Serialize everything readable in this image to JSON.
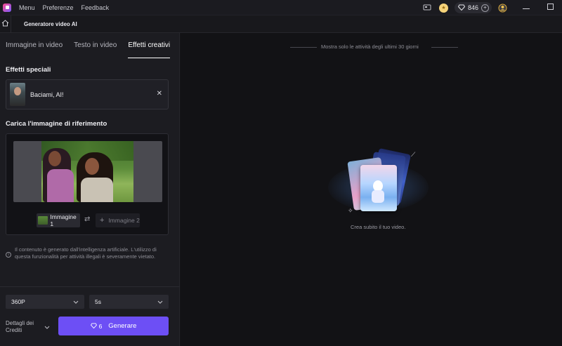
{
  "titlebar": {
    "menu_items": [
      "Menu",
      "Preferenze",
      "Feedback"
    ],
    "credits": "846",
    "icons": [
      "app-logo-icon",
      "monitor-icon",
      "coin-icon",
      "gem-icon",
      "plus-icon",
      "user-badge-icon",
      "minimize-icon",
      "maximize-icon"
    ]
  },
  "subbar": {
    "title": "Generatore video AI"
  },
  "left": {
    "tabs": [
      {
        "label": "Immagine in video",
        "active": false
      },
      {
        "label": "Testo in video",
        "active": false
      },
      {
        "label": "Effetti creativi",
        "active": true
      }
    ],
    "effects_title": "Effetti speciali",
    "effect": {
      "name": "Baciami, AI!"
    },
    "upload_title": "Carica l'immagine di riferimento",
    "image1_label": "Immagine 1",
    "image2_label": "Immagine 2",
    "notice": "Il contenuto è generato dall'intelligenza artificiale. L'utilizzo di questa funzionalità per attività illegali è severamente vietato.",
    "resolution": "360P",
    "duration": "5s",
    "details_label": "Dettagli dei Crediti",
    "generate": {
      "cost": "6",
      "label": "Generare"
    }
  },
  "right": {
    "filter_text": "Mostra solo le attività degli ultimi 30 giorni",
    "empty_caption": "Crea subito il tuo video."
  },
  "colors": {
    "accent": "#6d4ff5",
    "panel": "#1c1c21",
    "background": "#121215"
  }
}
